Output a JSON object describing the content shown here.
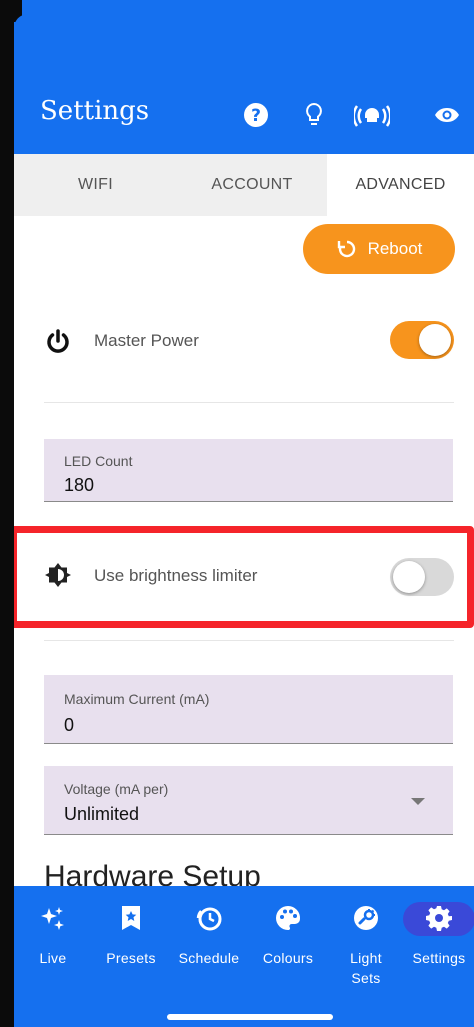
{
  "appbar": {
    "title": "Settings",
    "icons": [
      "help-icon",
      "bulb-icon",
      "broadcast-icon",
      "eye-icon"
    ]
  },
  "tabs": [
    {
      "label": "WIFI",
      "active": false
    },
    {
      "label": "ACCOUNT",
      "active": false
    },
    {
      "label": "ADVANCED",
      "active": true
    }
  ],
  "reboot": {
    "label": "Reboot",
    "icon": "restart-icon",
    "color": "#f7941d"
  },
  "master_power": {
    "label": "Master Power",
    "icon": "power-icon",
    "enabled": true
  },
  "led_count": {
    "label": "LED Count",
    "value": "180"
  },
  "brightness_limiter": {
    "label": "Use brightness limiter",
    "icon": "brightness-icon",
    "enabled": false,
    "highlight_color": "#f5242a"
  },
  "max_current": {
    "label": "Maximum Current (mA)",
    "value": "0"
  },
  "voltage": {
    "label": "Voltage (mA per)",
    "value": "Unlimited"
  },
  "hardware_setup_title": "Hardware Setup",
  "bottom_nav": [
    {
      "label": "Live",
      "icon": "sparkle-icon",
      "active": false
    },
    {
      "label": "Presets",
      "icon": "star-bookmark-icon",
      "active": false
    },
    {
      "label": "Schedule",
      "icon": "clock-icon",
      "active": false
    },
    {
      "label": "Colours",
      "icon": "palette-icon",
      "active": false
    },
    {
      "label": "Light Sets",
      "icon": "light-sets-icon",
      "active": false
    },
    {
      "label": "Settings",
      "icon": "gear-icon",
      "active": true
    }
  ],
  "colors": {
    "primary": "#1570ef",
    "accent": "#f7941d",
    "active_nav": "#3a49d8"
  }
}
